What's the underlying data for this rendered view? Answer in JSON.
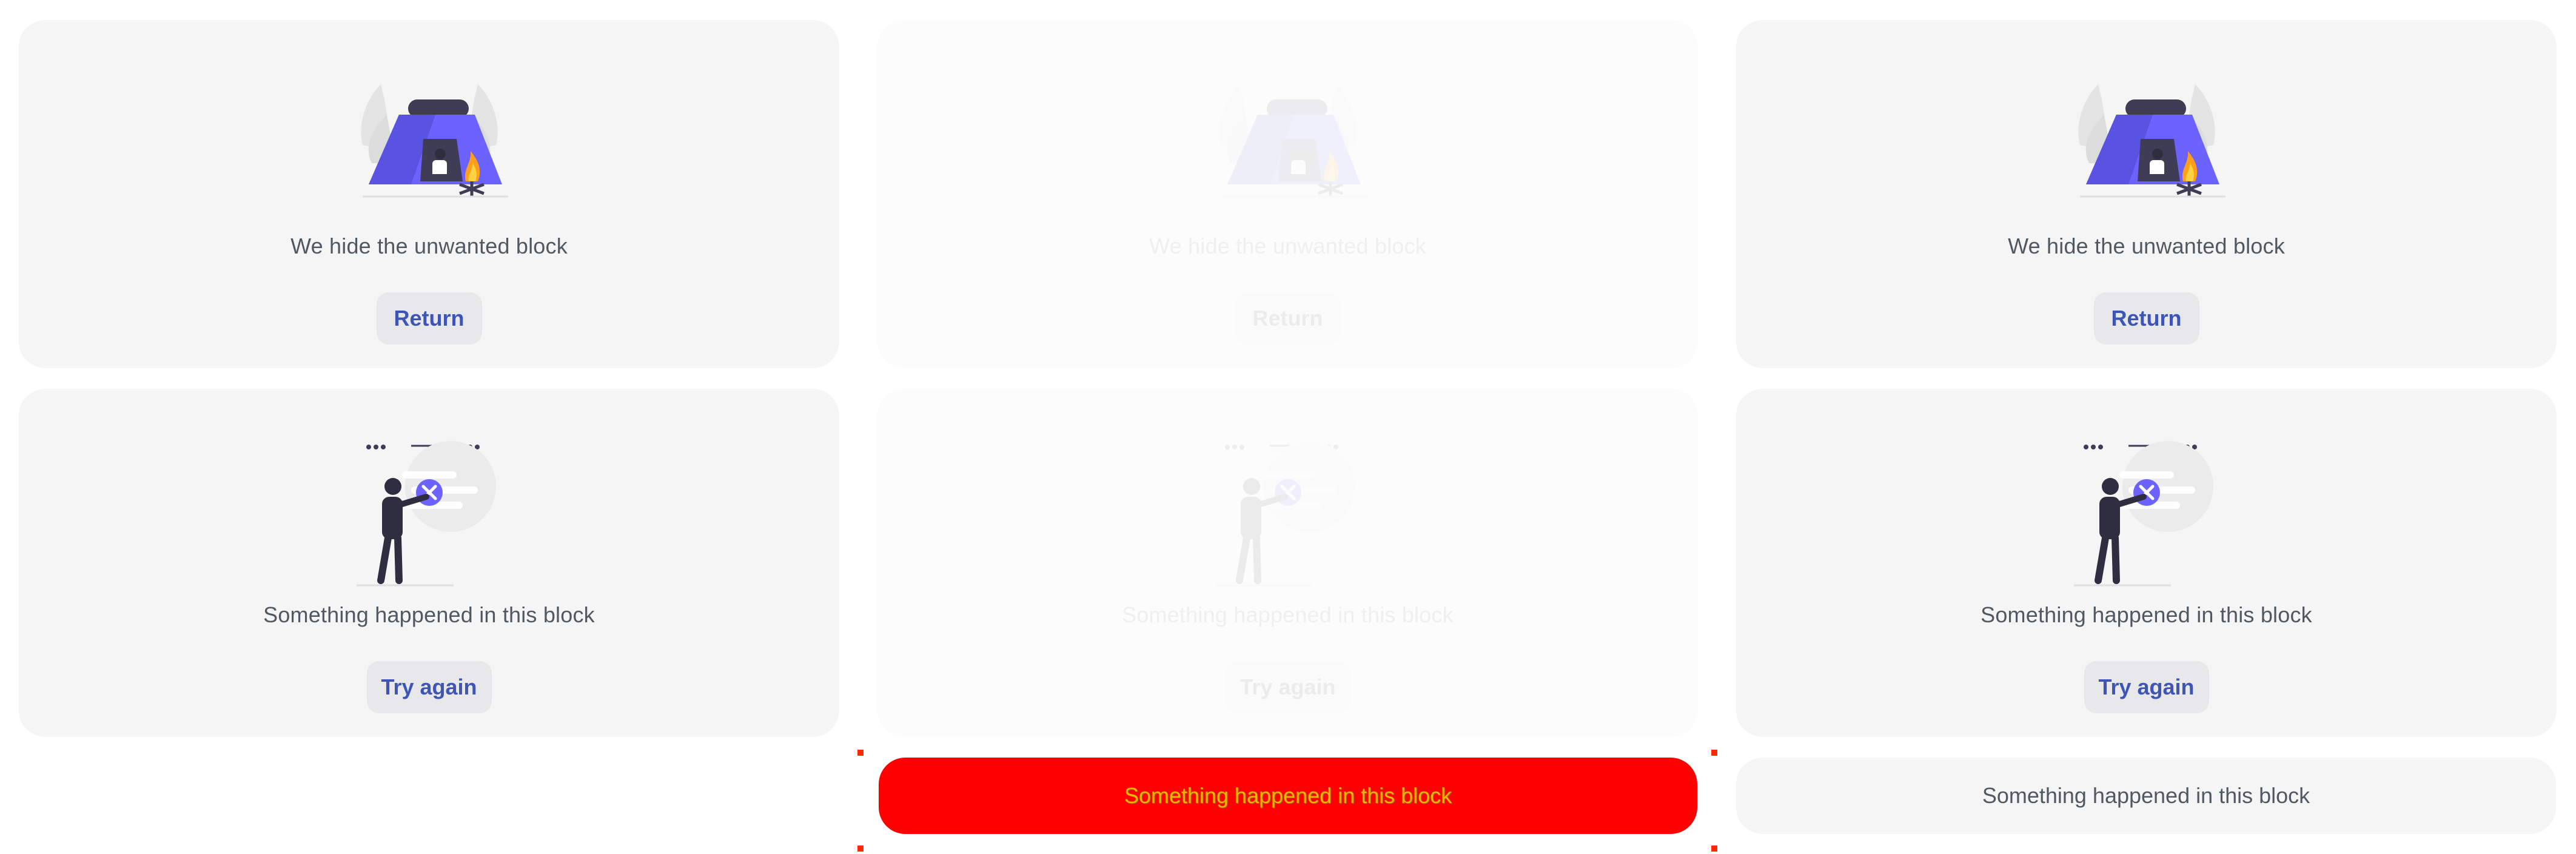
{
  "hidden_block": {
    "message": "We hide the unwanted block",
    "button_label": "Return"
  },
  "error_block": {
    "message": "Something happened in this block",
    "button_label": "Try again"
  },
  "compact_error": {
    "message": "Something happened in this block"
  },
  "colors": {
    "card_bg": "#f5f5f5",
    "accent": "#3e55b8",
    "illustration_purple": "#6c63ff",
    "error_red": "#ff0000",
    "error_text": "#f2b800"
  }
}
